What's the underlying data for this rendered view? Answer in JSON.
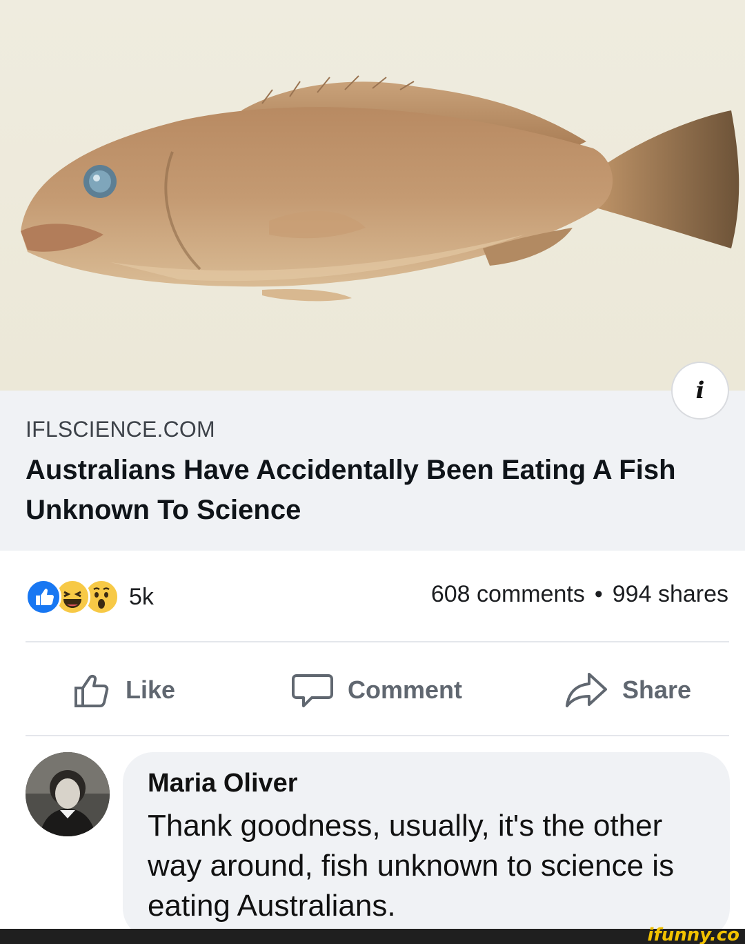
{
  "post": {
    "image_alt": "grouper fish",
    "info_icon": "info-icon",
    "domain": "IFLSCIENCE.COM",
    "headline": "Australians Have Accidentally Been Eating A Fish Unknown To Science"
  },
  "engagement": {
    "reaction_icons": [
      "like-reaction-icon",
      "haha-reaction-icon",
      "wow-reaction-icon"
    ],
    "reaction_count": "5k",
    "comments": "608 comments",
    "separator": "•",
    "shares": "994 shares"
  },
  "actions": {
    "like": "Like",
    "comment": "Comment",
    "share": "Share"
  },
  "comment": {
    "author": "Maria Oliver",
    "text": "Thank goodness, usually, it's the other way around, fish unknown to science is eating Australians."
  },
  "watermark": "ifunny.co",
  "colors": {
    "like_blue": "#1877f2",
    "emoji_yellow": "#f7c946",
    "link_bg": "#f0f2f5",
    "action_gray": "#606770"
  }
}
